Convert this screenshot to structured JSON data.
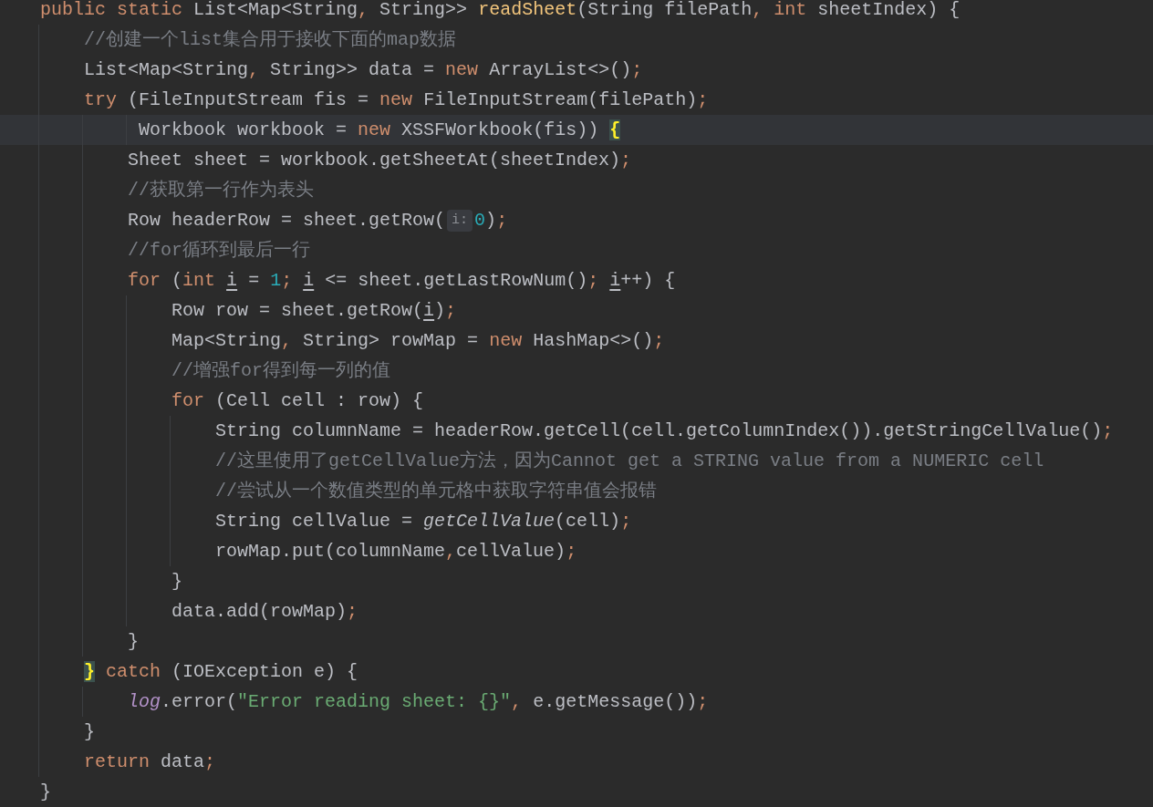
{
  "editor": {
    "lines": [
      {
        "current": false,
        "tokens": [
          {
            "kind": "keyword",
            "text": "public static "
          },
          {
            "kind": "plain",
            "text": "List<Map<String"
          },
          {
            "kind": "keyword",
            "text": ","
          },
          {
            "kind": "plain",
            "text": " String>> "
          },
          {
            "kind": "method",
            "text": "readSheet"
          },
          {
            "kind": "plain",
            "text": "(String filePath"
          },
          {
            "kind": "keyword",
            "text": ","
          },
          {
            "kind": "keyword",
            "text": " int"
          },
          {
            "kind": "plain",
            "text": " sheetIndex) {"
          }
        ]
      },
      {
        "current": false,
        "tokens": [
          {
            "kind": "comment",
            "text": "    //创建一个list集合用于接收下面的map数据"
          }
        ]
      },
      {
        "current": false,
        "tokens": [
          {
            "kind": "plain",
            "text": "    List<Map<String"
          },
          {
            "kind": "keyword",
            "text": ","
          },
          {
            "kind": "plain",
            "text": " String>> data = "
          },
          {
            "kind": "keyword",
            "text": "new"
          },
          {
            "kind": "plain",
            "text": " ArrayList<>()"
          },
          {
            "kind": "keyword",
            "text": ";"
          }
        ]
      },
      {
        "current": false,
        "tokens": [
          {
            "kind": "keyword",
            "text": "    try"
          },
          {
            "kind": "plain",
            "text": " (FileInputStream fis = "
          },
          {
            "kind": "keyword",
            "text": "new"
          },
          {
            "kind": "plain",
            "text": " FileInputStream(filePath)"
          },
          {
            "kind": "keyword",
            "text": ";"
          }
        ]
      },
      {
        "current": true,
        "tokens": [
          {
            "kind": "plain",
            "text": "         Workbook workbook = "
          },
          {
            "kind": "keyword",
            "text": "new"
          },
          {
            "kind": "plain",
            "text": " XSSFWorkbook(fis)) "
          },
          {
            "kind": "matched_brace",
            "text": "{"
          }
        ]
      },
      {
        "current": false,
        "tokens": [
          {
            "kind": "plain",
            "text": "        Sheet sheet = workbook.getSheetAt(sheetIndex)"
          },
          {
            "kind": "keyword",
            "text": ";"
          }
        ]
      },
      {
        "current": false,
        "tokens": [
          {
            "kind": "comment",
            "text": "        //获取第一行作为表头"
          }
        ]
      },
      {
        "current": false,
        "tokens": [
          {
            "kind": "plain",
            "text": "        Row headerRow = sheet.getRow("
          },
          {
            "kind": "hint",
            "text": "i:"
          },
          {
            "kind": "number",
            "text": "0"
          },
          {
            "kind": "plain",
            "text": ")"
          },
          {
            "kind": "keyword",
            "text": ";"
          }
        ]
      },
      {
        "current": false,
        "tokens": [
          {
            "kind": "comment",
            "text": "        //for循环到最后一行"
          }
        ]
      },
      {
        "current": false,
        "tokens": [
          {
            "kind": "keyword",
            "text": "        for"
          },
          {
            "kind": "plain",
            "text": " ("
          },
          {
            "kind": "keyword",
            "text": "int"
          },
          {
            "kind": "local_var",
            "text": " i"
          },
          {
            "kind": "plain",
            "text": " = "
          },
          {
            "kind": "number",
            "text": "1"
          },
          {
            "kind": "keyword",
            "text": ";"
          },
          {
            "kind": "local_var",
            "text": " i"
          },
          {
            "kind": "plain",
            "text": " <= sheet.getLastRowNum()"
          },
          {
            "kind": "keyword",
            "text": ";"
          },
          {
            "kind": "local_var",
            "text": " i"
          },
          {
            "kind": "plain",
            "text": "++) {"
          }
        ]
      },
      {
        "current": false,
        "tokens": [
          {
            "kind": "plain",
            "text": "            Row row = sheet.getRow("
          },
          {
            "kind": "local_var",
            "text": "i"
          },
          {
            "kind": "plain",
            "text": ")"
          },
          {
            "kind": "keyword",
            "text": ";"
          }
        ]
      },
      {
        "current": false,
        "tokens": [
          {
            "kind": "plain",
            "text": "            Map<String"
          },
          {
            "kind": "keyword",
            "text": ","
          },
          {
            "kind": "plain",
            "text": " String> rowMap = "
          },
          {
            "kind": "keyword",
            "text": "new"
          },
          {
            "kind": "plain",
            "text": " HashMap<>()"
          },
          {
            "kind": "keyword",
            "text": ";"
          }
        ]
      },
      {
        "current": false,
        "tokens": [
          {
            "kind": "comment",
            "text": "            //增强for得到每一列的值"
          }
        ]
      },
      {
        "current": false,
        "tokens": [
          {
            "kind": "keyword",
            "text": "            for"
          },
          {
            "kind": "plain",
            "text": " (Cell cell : row) {"
          }
        ]
      },
      {
        "current": false,
        "tokens": [
          {
            "kind": "plain",
            "text": "                String columnName = headerRow.getCell(cell.getColumnIndex()).getStringCellValue()"
          },
          {
            "kind": "keyword",
            "text": ";"
          }
        ]
      },
      {
        "current": false,
        "tokens": [
          {
            "kind": "comment",
            "text": "                //这里使用了getCellValue方法，因为Cannot get a STRING value from a NUMERIC cell"
          }
        ]
      },
      {
        "current": false,
        "tokens": [
          {
            "kind": "comment",
            "text": "                //尝试从一个数值类型的单元格中获取字符串值会报错"
          }
        ]
      },
      {
        "current": false,
        "tokens": [
          {
            "kind": "plain",
            "text": "                String cellValue = "
          },
          {
            "kind": "static_call",
            "text": "getCellValue"
          },
          {
            "kind": "plain",
            "text": "(cell)"
          },
          {
            "kind": "keyword",
            "text": ";"
          }
        ]
      },
      {
        "current": false,
        "tokens": [
          {
            "kind": "plain",
            "text": "                rowMap.put(columnName"
          },
          {
            "kind": "keyword",
            "text": ","
          },
          {
            "kind": "plain",
            "text": "cellValue)"
          },
          {
            "kind": "keyword",
            "text": ";"
          }
        ]
      },
      {
        "current": false,
        "tokens": [
          {
            "kind": "plain",
            "text": "            }"
          }
        ]
      },
      {
        "current": false,
        "tokens": [
          {
            "kind": "plain",
            "text": "            data.add(rowMap)"
          },
          {
            "kind": "keyword",
            "text": ";"
          }
        ]
      },
      {
        "current": false,
        "tokens": [
          {
            "kind": "plain",
            "text": "        }"
          }
        ]
      },
      {
        "current": false,
        "tokens": [
          {
            "kind": "matched_brace",
            "text": "    }"
          },
          {
            "kind": "keyword",
            "text": " catch"
          },
          {
            "kind": "plain",
            "text": " (IOException e) {"
          }
        ]
      },
      {
        "current": false,
        "tokens": [
          {
            "kind": "static_field",
            "text": "        log"
          },
          {
            "kind": "plain",
            "text": ".error("
          },
          {
            "kind": "string",
            "text": "\"Error reading sheet: {}\""
          },
          {
            "kind": "keyword",
            "text": ","
          },
          {
            "kind": "plain",
            "text": " e.getMessage())"
          },
          {
            "kind": "keyword",
            "text": ";"
          }
        ]
      },
      {
        "current": false,
        "tokens": [
          {
            "kind": "plain",
            "text": "    }"
          }
        ]
      },
      {
        "current": false,
        "tokens": [
          {
            "kind": "keyword",
            "text": "    return"
          },
          {
            "kind": "plain",
            "text": " data"
          },
          {
            "kind": "keyword",
            "text": ";"
          }
        ]
      },
      {
        "current": false,
        "tokens": [
          {
            "kind": "plain",
            "text": "}"
          }
        ]
      }
    ]
  }
}
